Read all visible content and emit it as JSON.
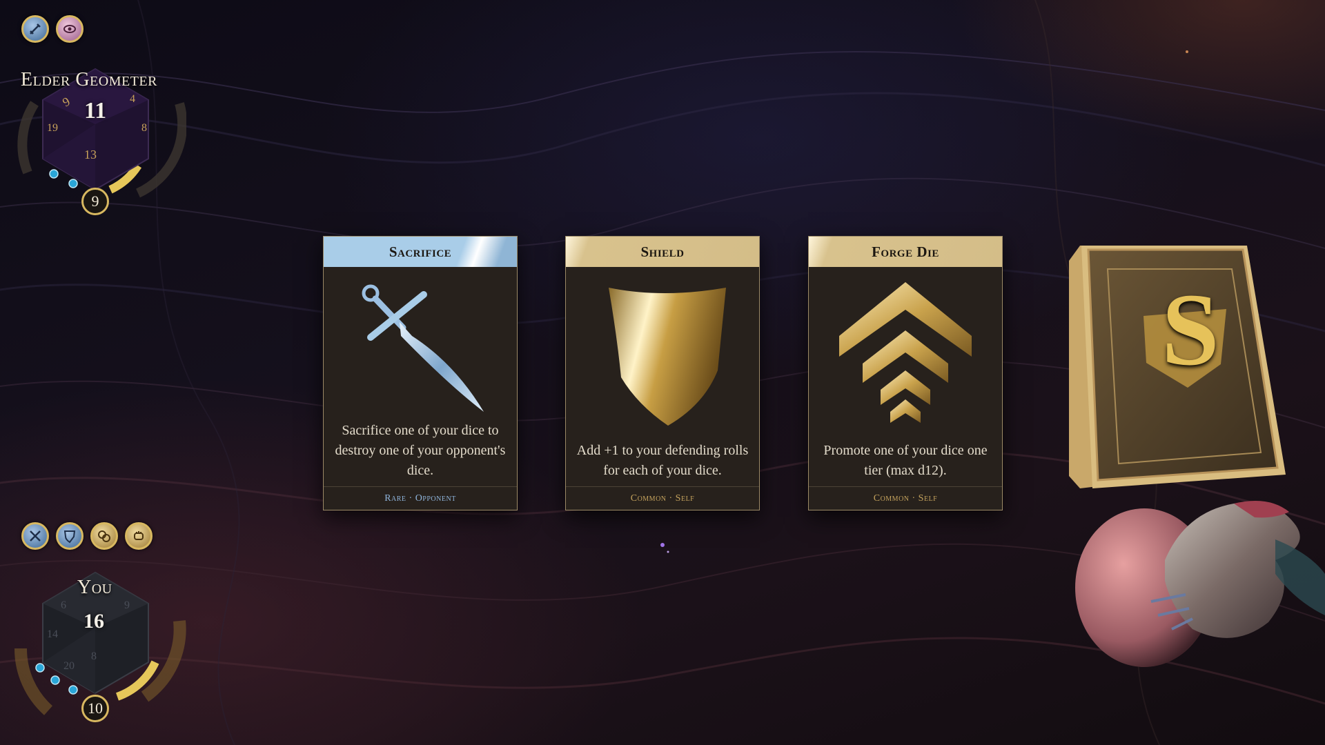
{
  "opponent": {
    "name": "Elder Geometer",
    "die_value": "11",
    "tokens": "9",
    "status_icons": [
      "sword-icon",
      "eye-icon"
    ]
  },
  "player": {
    "name": "You",
    "die_value": "16",
    "tokens": "10",
    "status_icons": [
      "crossed-swords-icon",
      "shield-icon",
      "coins-icon",
      "fist-icon"
    ]
  },
  "cards": [
    {
      "title": "Sacrifice",
      "description": "Sacrifice one of your dice to destroy one of your opponent's dice.",
      "rarity": "Rare",
      "target": "Opponent",
      "footer": "Rare · Opponent",
      "icon": "dagger-icon",
      "color": "#a9cde8"
    },
    {
      "title": "Shield",
      "description": "Add +1 to your defending rolls for each of your dice.",
      "rarity": "Common",
      "target": "Self",
      "footer": "Common · Self",
      "icon": "shield-icon",
      "color": "#d4bd88"
    },
    {
      "title": "Forge Die",
      "description": "Promote one of your dice one tier (max d12).",
      "rarity": "Common",
      "target": "Self",
      "footer": "Common · Self",
      "icon": "chevrons-up-icon",
      "color": "#d4bd88"
    }
  ],
  "deck": {
    "emblem": "S"
  },
  "colors": {
    "gold": "#d8b860",
    "rare": "#a9cde8",
    "common": "#d4bd88"
  }
}
